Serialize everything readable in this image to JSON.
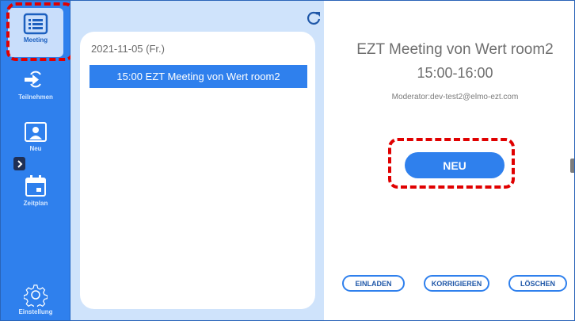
{
  "sidebar": {
    "items": [
      {
        "label": "Meeting",
        "icon": "list-icon",
        "active": true
      },
      {
        "label": "Teilnehmen",
        "icon": "join-icon",
        "active": false
      },
      {
        "label": "Neu",
        "icon": "person-screen-icon",
        "active": false
      },
      {
        "label": "Zeitplan",
        "icon": "calendar-icon",
        "active": false
      },
      {
        "label": "Einstellung",
        "icon": "gear-icon",
        "active": false
      }
    ]
  },
  "list": {
    "date": "2021-11-05 (Fr.)",
    "meetings": [
      {
        "label": "15:00  EZT Meeting von Wert room2"
      }
    ]
  },
  "detail": {
    "title": "EZT Meeting von Wert room2",
    "time": "15:00-16:00",
    "moderator": "Moderator:dev-test2@elmo-ezt.com",
    "new_button": "NEU",
    "actions": {
      "invite": "EINLADEN",
      "edit": "KORRIGIEREN",
      "delete": "LÖSCHEN"
    }
  },
  "colors": {
    "accent": "#2f80ed",
    "highlight": "#e00000",
    "list_bg": "#cfe3fb"
  }
}
